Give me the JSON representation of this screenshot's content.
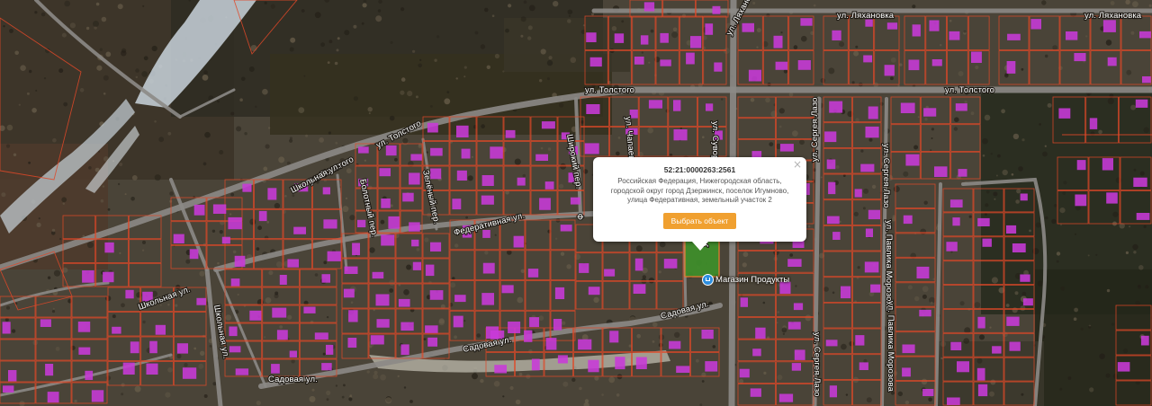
{
  "map": {
    "colors": {
      "ground": "#4a4438",
      "road": "#8c8a86",
      "parcel_outline": "#e04828",
      "building": "#c83ad8",
      "snow": "#c9d4dc",
      "selected_parcel": "#3e8f2a"
    },
    "streets": [
      {
        "name": "ул. Ляхановка"
      },
      {
        "name": "ул. Ляхановка"
      },
      {
        "name": "ул. Ляхановка"
      },
      {
        "name": "ул. Толстого"
      },
      {
        "name": "ул. Толстого"
      },
      {
        "name": "ул. Толстого"
      },
      {
        "name": "ул. Толстого"
      },
      {
        "name": "Школьная ул."
      },
      {
        "name": "Болотный пер."
      },
      {
        "name": "Зелёный пер."
      },
      {
        "name": "Широкий пер."
      },
      {
        "name": "ул. Чапаева"
      },
      {
        "name": "ул. Суворова"
      },
      {
        "name": "ул. Сергея Лазо"
      },
      {
        "name": "ул. Сергея Лазо"
      },
      {
        "name": "ул. Павлика Морозова"
      },
      {
        "name": "ул. Павлика Морозова"
      },
      {
        "name": "Федеративная ул."
      },
      {
        "name": "Школьная ул."
      },
      {
        "name": "Школьная ул."
      },
      {
        "name": "Садовая ул."
      },
      {
        "name": "Садовая ул."
      },
      {
        "name": "Садовая ул."
      },
      {
        "name": "ул. Сергея Лазо"
      },
      {
        "name": "ул. Су"
      },
      {
        "name": "Ф"
      }
    ],
    "poi": {
      "icon": "shop-icon",
      "label": "Магазин Продукты"
    }
  },
  "popup": {
    "cadastral_number": "52:21:0000263:2561",
    "address_line1": "Российская Федерация, Нижегородская область,",
    "address_line2": "городской округ город Дзержинск, поселок Игумново,",
    "address_line3": "улица Федеративная, земельный участок 2",
    "select_button_label": "Выбрать объект",
    "close_symbol": "×"
  }
}
